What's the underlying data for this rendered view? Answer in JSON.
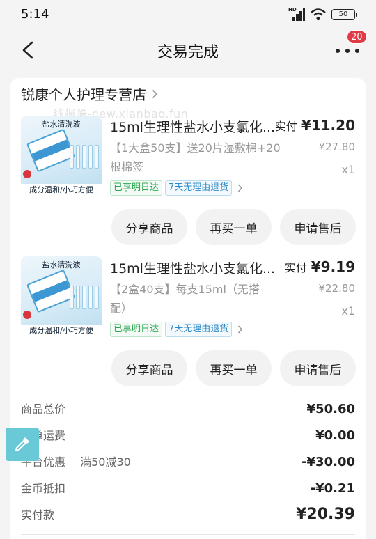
{
  "status_bar": {
    "time": "5:14",
    "network": "HD",
    "battery": "50"
  },
  "nav": {
    "title": "交易完成",
    "badge_count": "20"
  },
  "store": {
    "name": "锐康个人护理专营店"
  },
  "watermark": "线报酷-new.xianbao.fun",
  "products": [
    {
      "title": "15ml生理性盐水小支氯化...",
      "sku": "【1大盒50支】送20片湿敷棉+20根棉签",
      "tags": [
        "已享明日达",
        "7天无理由退货"
      ],
      "paid_label": "实付",
      "paid_value": "¥11.20",
      "original_price": "¥27.80",
      "quantity": "x1",
      "thumb_top": "盐水清洗液",
      "thumb_bottom": "成分温和/小巧方便",
      "buttons": [
        "分享商品",
        "再买一单",
        "申请售后"
      ]
    },
    {
      "title": "15ml生理性盐水小支氯化...",
      "sku": "【2盒40支】每支15ml（无搭配）",
      "tags": [
        "已享明日达",
        "7天无理由退货"
      ],
      "paid_label": "实付",
      "paid_value": "¥9.19",
      "original_price": "¥22.80",
      "quantity": "x1",
      "thumb_top": "盐水清洗液",
      "thumb_bottom": "成分温和/小巧方便",
      "buttons": [
        "分享商品",
        "再买一单",
        "申请售后"
      ]
    }
  ],
  "summary": {
    "goods_total_label": "商品总价",
    "goods_total": "¥50.60",
    "shipping_label": "订单运费",
    "shipping": "¥0.00",
    "discount_label": "平台优惠",
    "discount_note": "满50减30",
    "discount": "-¥30.00",
    "coins_label": "金币抵扣",
    "coins": "-¥0.21",
    "paid_label": "实付款",
    "paid": "¥20.39"
  },
  "colors": {
    "accent": "#e23a45",
    "tag_green": "#2aa84f",
    "tag_blue": "#2d8bc7",
    "float_tool": "#69c9d6"
  },
  "icons": [
    "back-arrow-icon",
    "more-icon",
    "chevron-right-icon",
    "signal-icon",
    "wifi-icon",
    "battery-icon",
    "eyedropper-icon"
  ]
}
